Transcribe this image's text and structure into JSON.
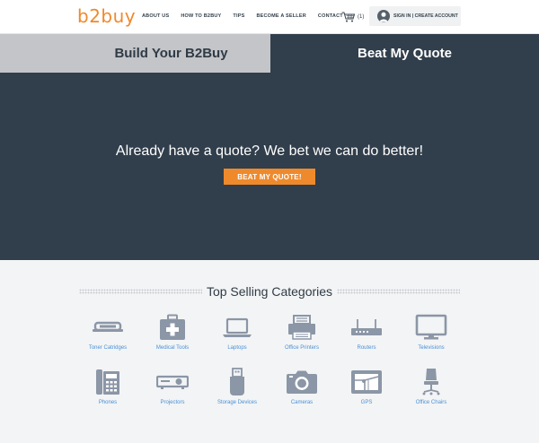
{
  "header": {
    "logo": "b2buy",
    "nav": [
      "ABOUT US",
      "HOW TO B2BUY",
      "TIPS",
      "BECOME A SELLER",
      "CONTACT"
    ],
    "cart_count": "(1)",
    "account_label": "SIGN IN | CREATE ACCOUNT"
  },
  "tabs": {
    "build": "Build Your B2Buy",
    "beat": "Beat My Quote"
  },
  "hero": {
    "headline": "Already have a quote? We bet we can do better!",
    "button": "BEAT MY QUOTE!"
  },
  "categories": {
    "title": "Top Selling Categories",
    "icon_color": "#8b96a6",
    "items": [
      {
        "label": "Toner Catridges",
        "icon": "toner-icon"
      },
      {
        "label": "Medical Tools",
        "icon": "medical-kit-icon"
      },
      {
        "label": "Laptops",
        "icon": "laptop-icon"
      },
      {
        "label": "Office Printers",
        "icon": "printer-icon"
      },
      {
        "label": "Routers",
        "icon": "router-icon"
      },
      {
        "label": "Televisions",
        "icon": "television-icon"
      },
      {
        "label": "Phones",
        "icon": "phone-icon"
      },
      {
        "label": "Projectors",
        "icon": "projector-icon"
      },
      {
        "label": "Storage Devices",
        "icon": "usb-drive-icon"
      },
      {
        "label": "Cameras",
        "icon": "camera-icon"
      },
      {
        "label": "GPS",
        "icon": "gps-icon"
      },
      {
        "label": "Office Chairs",
        "icon": "office-chair-icon"
      }
    ]
  },
  "colors": {
    "accent": "#ef8a2c",
    "dark": "#313e4b",
    "link_blue": "#4a90d6"
  }
}
